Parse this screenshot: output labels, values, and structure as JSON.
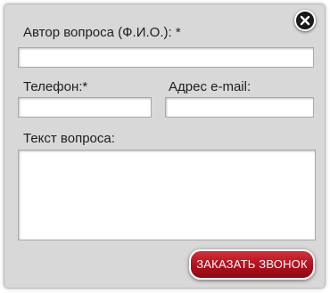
{
  "form": {
    "author_label": "Автор вопроса (Ф.И.О.): *",
    "author_value": "",
    "phone_label": "Телефон:*",
    "phone_value": "",
    "email_label": "Адрес e-mail:",
    "email_value": "",
    "question_label": "Текст вопроса:",
    "question_value": "",
    "submit_label": "ЗАКАЗАТЬ ЗВОНОК"
  },
  "icons": {
    "close": "close-icon"
  },
  "colors": {
    "panel_bg": "#d8d8d8",
    "button_red": "#b0101c",
    "close_bg": "#1a1a1a"
  }
}
